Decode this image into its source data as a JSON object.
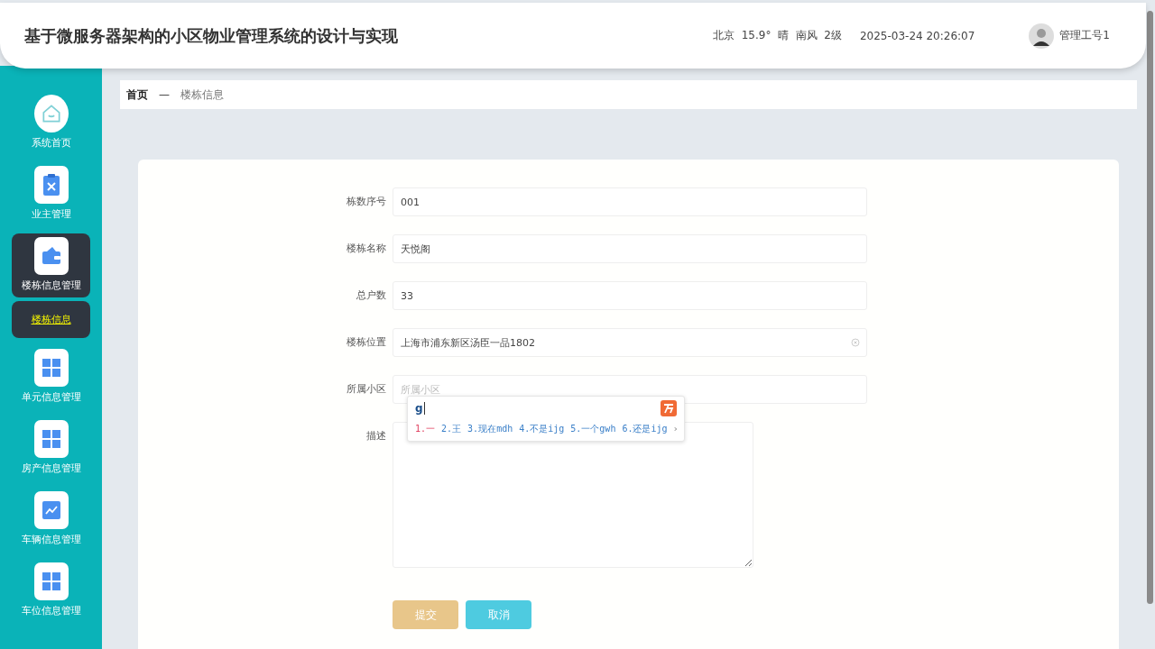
{
  "header": {
    "title": "基于微服务器架构的小区物业管理系统的设计与实现",
    "weather": "北京  15.9°  晴  南风  2级",
    "datetime": "2025-03-24 20:26:07",
    "user": "管理工号1"
  },
  "sidebar": {
    "items": [
      {
        "label": "系统首页",
        "kind": "home",
        "selected": false
      },
      {
        "label": "业主管理",
        "kind": "clipboard",
        "selected": false
      },
      {
        "label": "楼栋信息管理",
        "kind": "wallet",
        "selected": true,
        "children": [
          {
            "label": "楼栋信息",
            "selected": true
          }
        ]
      },
      {
        "label": "单元信息管理",
        "kind": "grid",
        "selected": false
      },
      {
        "label": "房产信息管理",
        "kind": "grid",
        "selected": false
      },
      {
        "label": "车辆信息管理",
        "kind": "chart",
        "selected": false
      },
      {
        "label": "车位信息管理",
        "kind": "grid",
        "selected": false
      }
    ]
  },
  "breadcrumb": {
    "home": "首页",
    "separator": "—",
    "current": "楼栋信息"
  },
  "form": {
    "fields": [
      {
        "label": "栋数序号",
        "kind": "text",
        "value": "001"
      },
      {
        "label": "楼栋名称",
        "kind": "text",
        "value": "天悦阁"
      },
      {
        "label": "总户数",
        "kind": "text",
        "value": "33"
      },
      {
        "label": "楼栋位置",
        "kind": "text",
        "value": "上海市浦东新区汤臣一品1802",
        "clearable": true
      },
      {
        "label": "所属小区",
        "kind": "text",
        "placeholder": "所属小区"
      },
      {
        "label": "描述",
        "kind": "textarea"
      }
    ],
    "buttons": [
      {
        "label": "提交",
        "kind": "submit"
      },
      {
        "label": "取消",
        "kind": "cancel"
      }
    ]
  },
  "ime": {
    "input": "g",
    "candidates": [
      {
        "text": "1.一",
        "selected": true
      },
      {
        "text": "2.王",
        "selected": false
      },
      {
        "text": "3.现在mdh",
        "selected": false
      },
      {
        "text": "4.不是ijg",
        "selected": false
      },
      {
        "text": "5.一个gwh",
        "selected": false
      },
      {
        "text": "6.还是ijg",
        "selected": false
      }
    ]
  }
}
